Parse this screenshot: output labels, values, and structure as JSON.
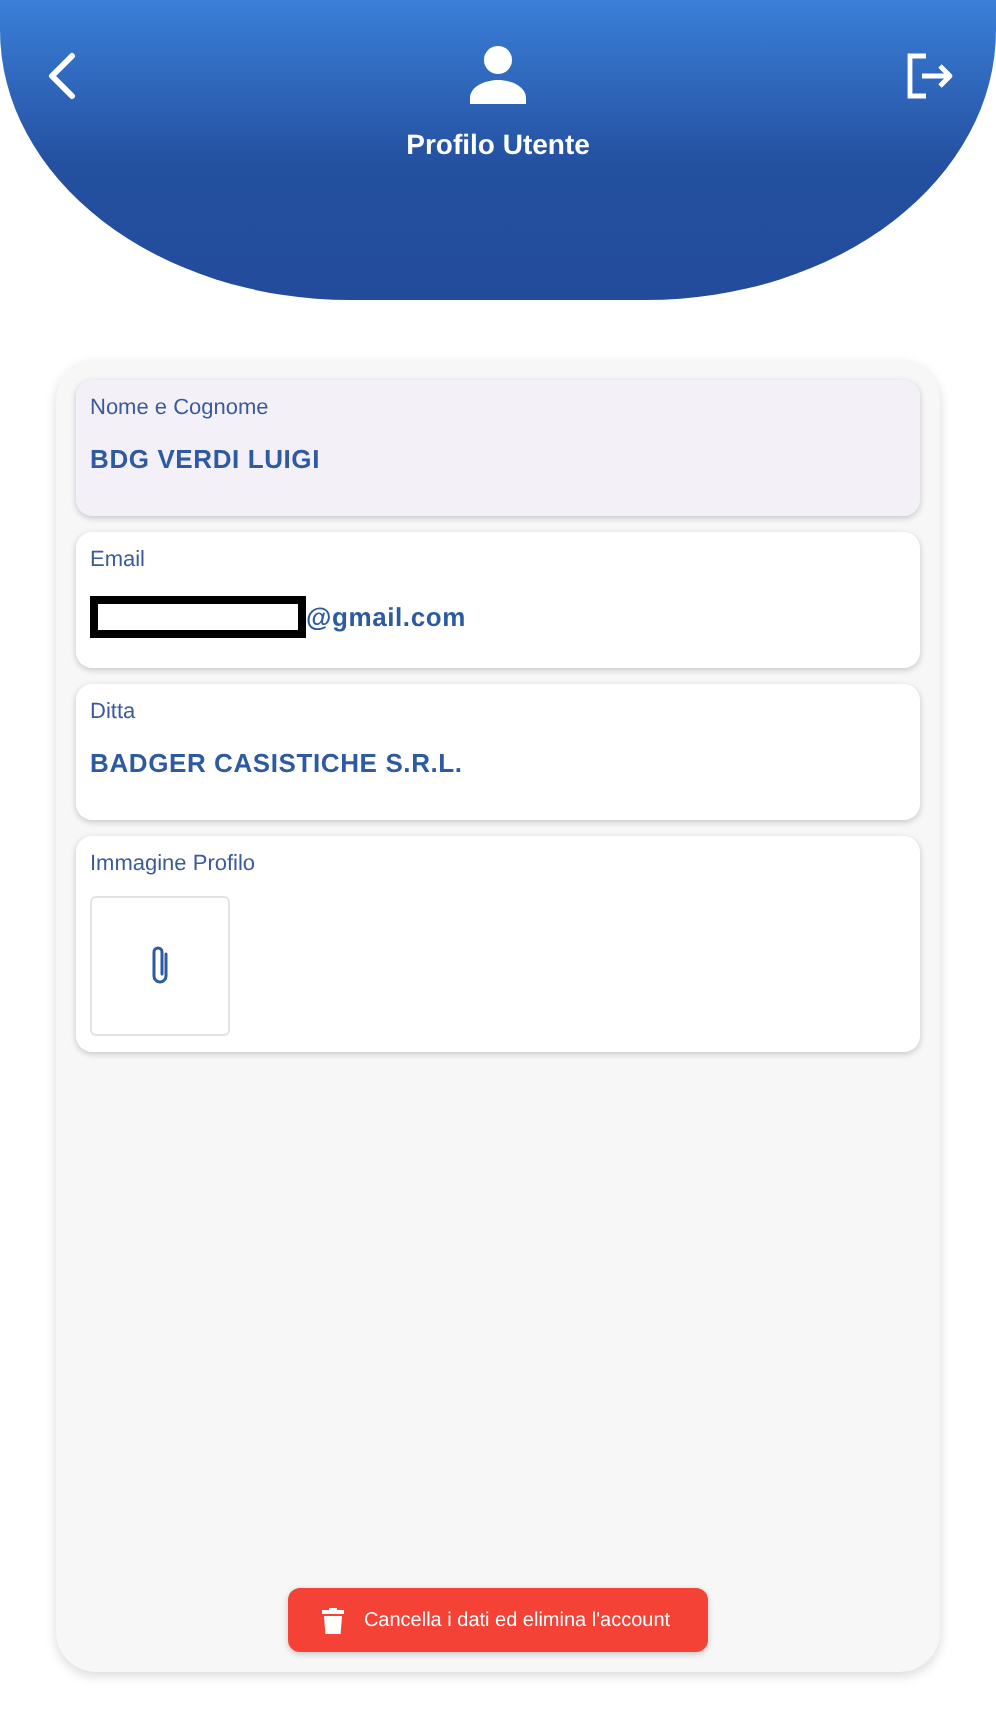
{
  "header": {
    "title": "Profilo Utente"
  },
  "fields": [
    {
      "kind": "text",
      "label": "Nome e Cognome",
      "value": "BDG VERDI LUIGI",
      "selected": true,
      "redacted": false
    },
    {
      "kind": "text",
      "label": "Email",
      "value": "@gmail.com",
      "selected": false,
      "redacted": true
    },
    {
      "kind": "text",
      "label": "Ditta",
      "value": "BADGER CASISTICHE S.R.L.",
      "selected": false,
      "redacted": false
    },
    {
      "kind": "image",
      "label": "Immagine Profilo",
      "selected": false
    }
  ],
  "delete_button": {
    "label": "Cancella i dati ed elimina l'account"
  }
}
